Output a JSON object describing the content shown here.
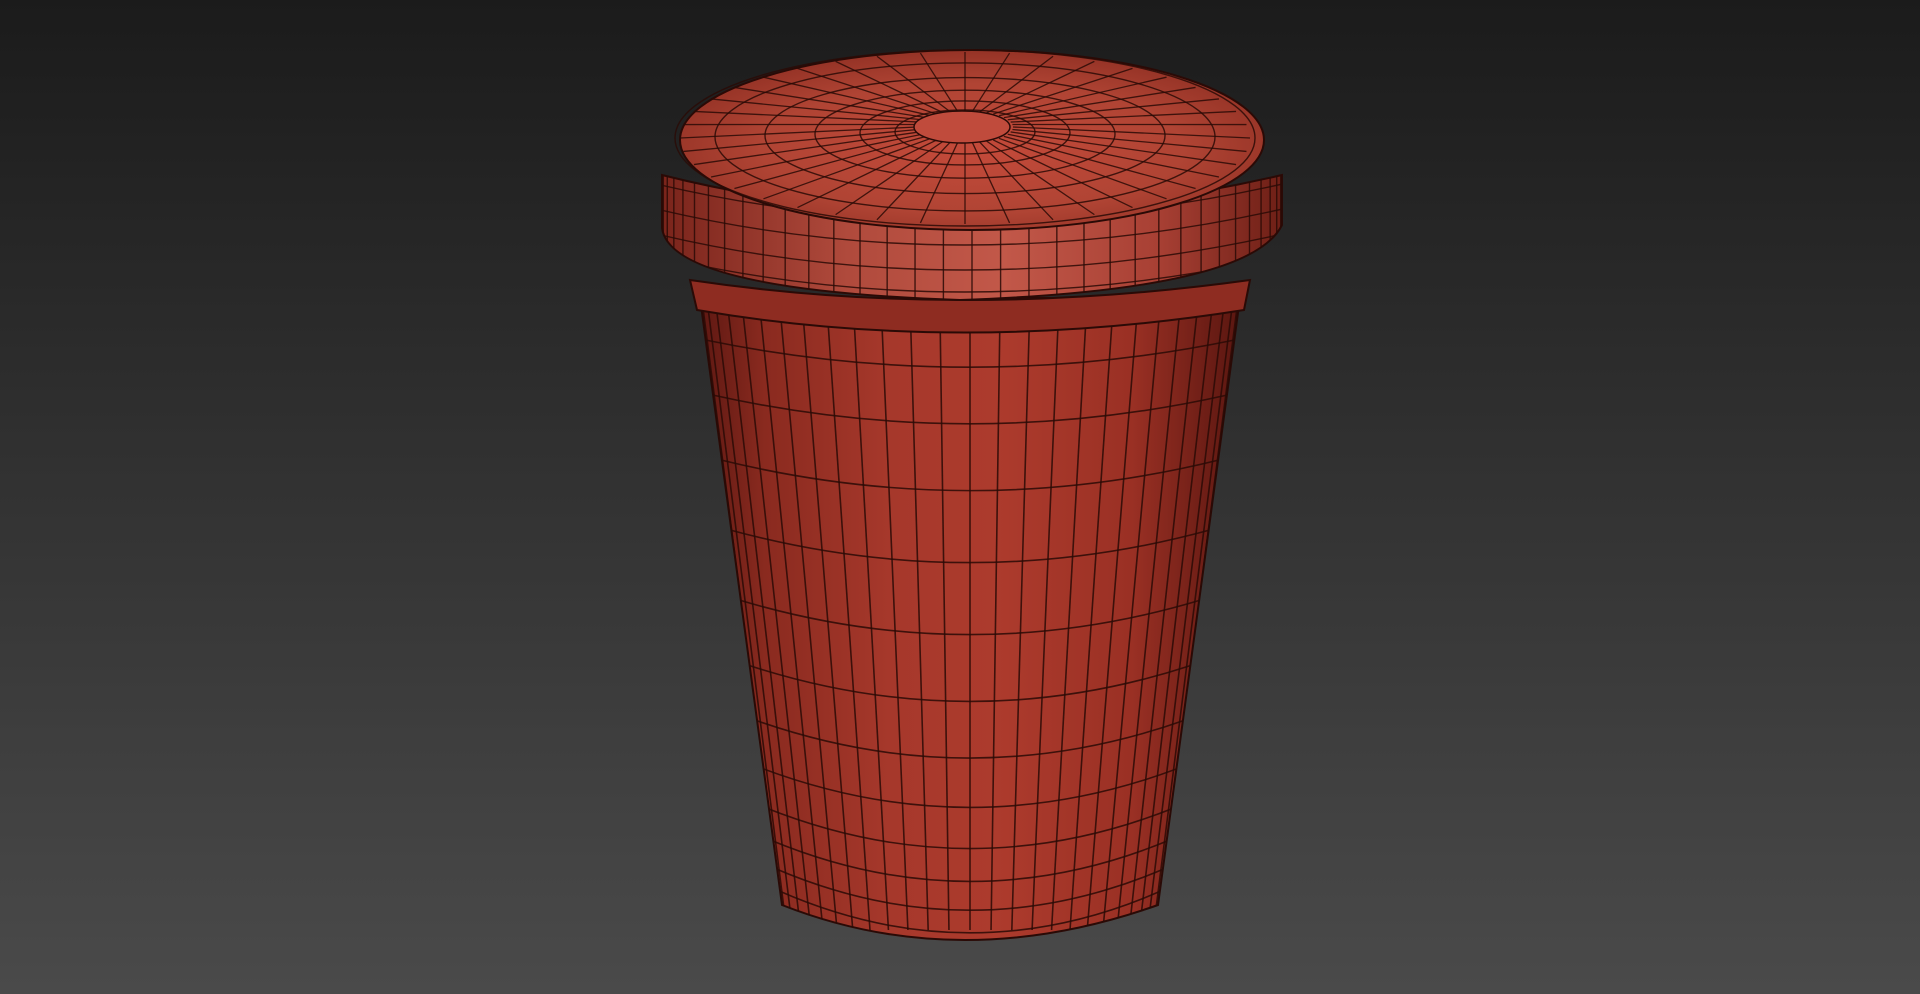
{
  "scene": {
    "background_top": "#1b1b1b",
    "background_bottom": "#4a4a4a",
    "model": {
      "name": "cup-with-lid",
      "render_mode": "wireframe-on-shaded",
      "base_color": "#a6362a",
      "base_color_light": "#c44a3a",
      "base_color_dark": "#6e1e16",
      "wire_color": "#2a0a06"
    }
  }
}
